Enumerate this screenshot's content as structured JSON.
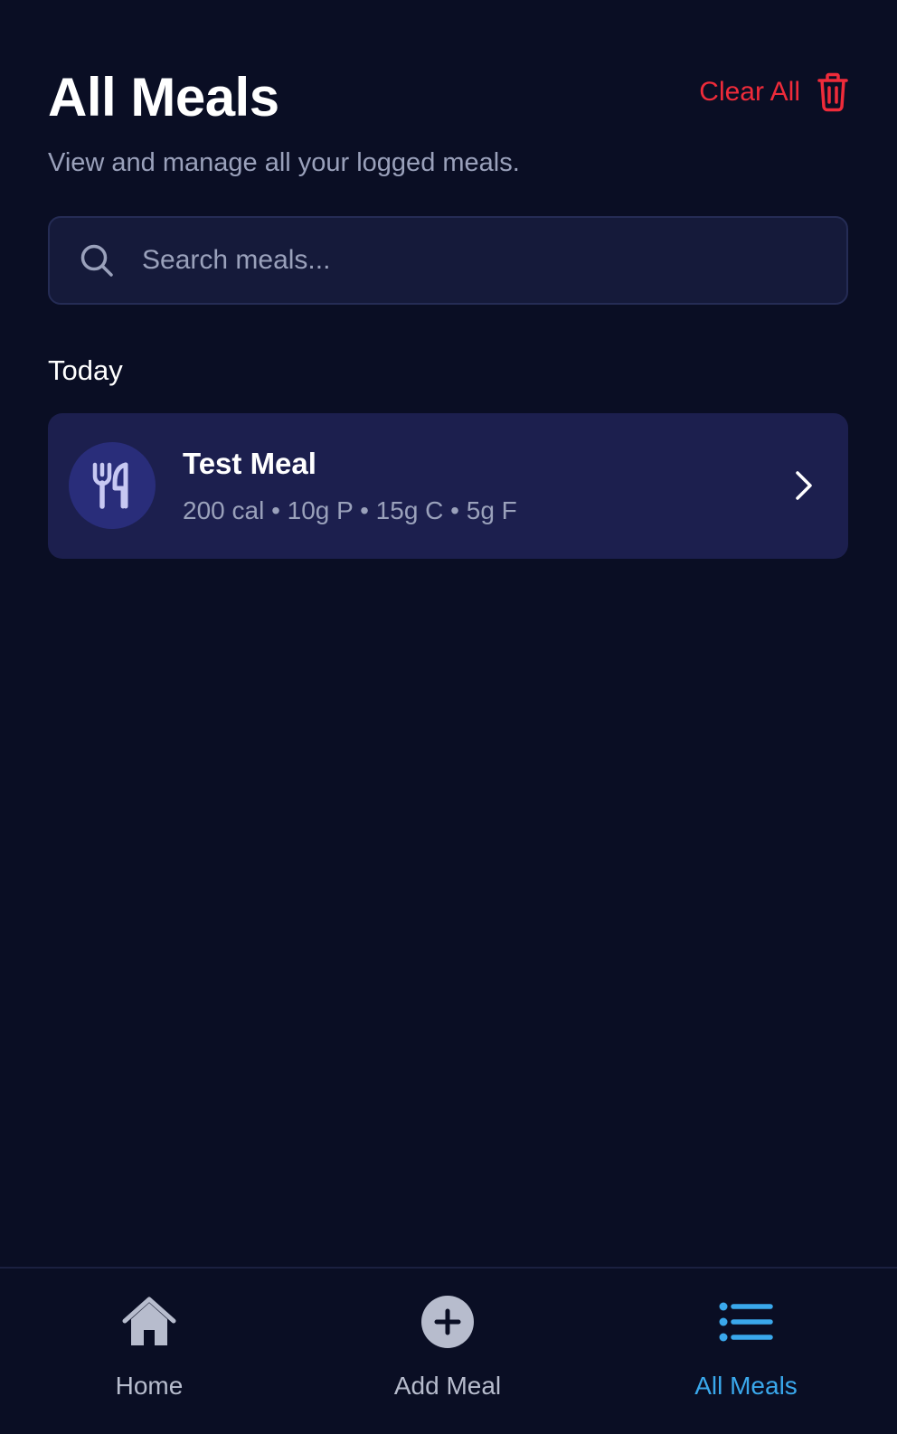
{
  "header": {
    "title": "All Meals",
    "clear_all_label": "Clear All",
    "clear_all_icon": "trash-icon",
    "subtitle": "View and manage all your logged meals."
  },
  "search": {
    "icon": "search-icon",
    "placeholder": "Search meals...",
    "value": ""
  },
  "sections": [
    {
      "heading": "Today",
      "meals": [
        {
          "icon": "utensils-icon",
          "name": "Test Meal",
          "macros": "200 cal • 10g P • 15g C • 5g F",
          "chevron": "chevron-right-icon"
        }
      ]
    }
  ],
  "tab_bar": {
    "active": "All Meals",
    "tabs": [
      {
        "label": "Home",
        "icon": "home-icon"
      },
      {
        "label": "Add Meal",
        "icon": "plus-circle-icon"
      },
      {
        "label": "All Meals",
        "icon": "list-icon"
      }
    ]
  },
  "colors": {
    "background": "#0a0e24",
    "danger": "#ef2b3a",
    "accent": "#3aa8ec",
    "card": "#1c1f4e",
    "muted_text": "#9aa1bb"
  }
}
